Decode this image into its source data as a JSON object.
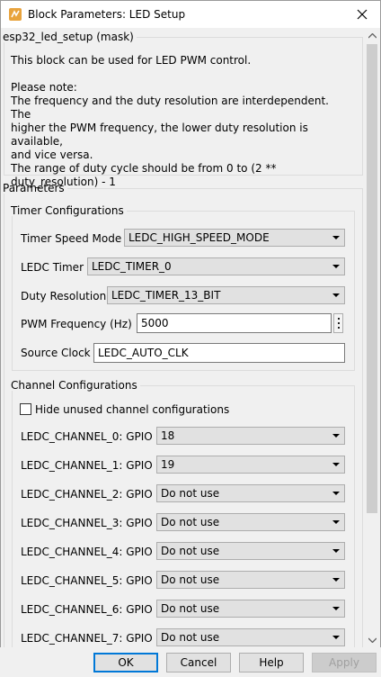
{
  "window": {
    "title": "Block Parameters: LED Setup"
  },
  "mask": {
    "legend": "esp32_led_setup (mask)",
    "description_line1": "This block can be used for LED PWM control.",
    "note_lines": [
      "Please note:",
      "The frequency and the duty resolution are interdependent. The",
      "higher the PWM frequency, the lower duty resolution is available,",
      "and vice versa.",
      "The range of duty cycle should be from 0 to (2 **",
      "duty_resolution) - 1"
    ]
  },
  "parameters": {
    "legend": "Parameters",
    "timer": {
      "legend": "Timer Configurations",
      "speed_mode": {
        "label": "Timer Speed Mode",
        "value": "LEDC_HIGH_SPEED_MODE"
      },
      "ledc_timer": {
        "label": "LEDC Timer",
        "value": "LEDC_TIMER_0"
      },
      "duty_resolution": {
        "label": "Duty Resolution",
        "value": "LEDC_TIMER_13_BIT"
      },
      "pwm_frequency": {
        "label": "PWM Frequency (Hz)",
        "value": "5000"
      },
      "source_clock": {
        "label": "Source Clock",
        "value": "LEDC_AUTO_CLK"
      }
    },
    "channels": {
      "legend": "Channel Configurations",
      "hide_unused_label": "Hide unused channel configurations",
      "items": [
        {
          "label": "LEDC_CHANNEL_0: GPIO",
          "value": "18"
        },
        {
          "label": "LEDC_CHANNEL_1: GPIO",
          "value": "19"
        },
        {
          "label": "LEDC_CHANNEL_2: GPIO",
          "value": "Do not use"
        },
        {
          "label": "LEDC_CHANNEL_3: GPIO",
          "value": "Do not use"
        },
        {
          "label": "LEDC_CHANNEL_4: GPIO",
          "value": "Do not use"
        },
        {
          "label": "LEDC_CHANNEL_5: GPIO",
          "value": "Do not use"
        },
        {
          "label": "LEDC_CHANNEL_6: GPIO",
          "value": "Do not use"
        },
        {
          "label": "LEDC_CHANNEL_7: GPIO",
          "value": "Do not use"
        }
      ]
    }
  },
  "buttons": {
    "ok": "OK",
    "cancel": "Cancel",
    "help": "Help",
    "apply": "Apply"
  },
  "icons": {
    "window": "simulink-block-icon",
    "close": "close-icon",
    "menu": "kebab-menu-icon"
  }
}
